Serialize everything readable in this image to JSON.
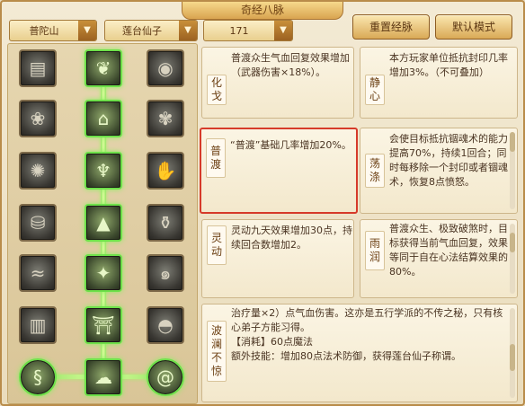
{
  "title": "奇经八脉",
  "sect_select": "普陀山",
  "school_select": "莲台仙子",
  "level_select": "171",
  "reset_button": "重置经脉",
  "default_button": "默认模式",
  "skill_icons": [
    "scroll-icon",
    "vine-icon",
    "orb-icon",
    "lotus-icon",
    "pagoda-icon",
    "paw-icon",
    "flame-icon",
    "figure-icon",
    "hand-icon",
    "pour-icon",
    "mountain-icon",
    "vase-icon",
    "wave-icon",
    "dragon-icon",
    "swirl-icon",
    "book-icon",
    "temple-icon",
    "dome-icon",
    "serpent-icon",
    "cloud-icon",
    "swirl-round-icon"
  ],
  "cards": {
    "huage": {
      "name": "化戈",
      "desc": "普渡众生气血回复效果增加（武器伤害×18%）。"
    },
    "jingxin": {
      "name": "静心",
      "desc": "本方玩家单位抵抗封印几率增加3%。（不可叠加）"
    },
    "pudu": {
      "name": "普渡",
      "desc": "“普渡”基础几率增加20%。"
    },
    "dangdi": {
      "name": "荡涤",
      "desc": "会使目标抵抗锢魂术的能力提高70%，持续1回合；同时每移除一个封印或者锢魂术，恢复8点愤怒。"
    },
    "lingdong": {
      "name": "灵动",
      "desc": "灵动九天效果增加30点，持续回合数增加2。"
    },
    "yurun": {
      "name": "雨润",
      "desc": "普渡众生、极致破煞时，目标获得当前气血回复，效果等同于自在心法结算效果的80%。"
    },
    "bolan": {
      "name": "波澜不惊",
      "desc": "治疗量×2）点气血伤害。这亦是五行学派的不传之秘，只有核心弟子方能习得。\n【消耗】60点魔法\n额外技能：增加80点法术防御，获得莲台仙子称谓。"
    }
  }
}
